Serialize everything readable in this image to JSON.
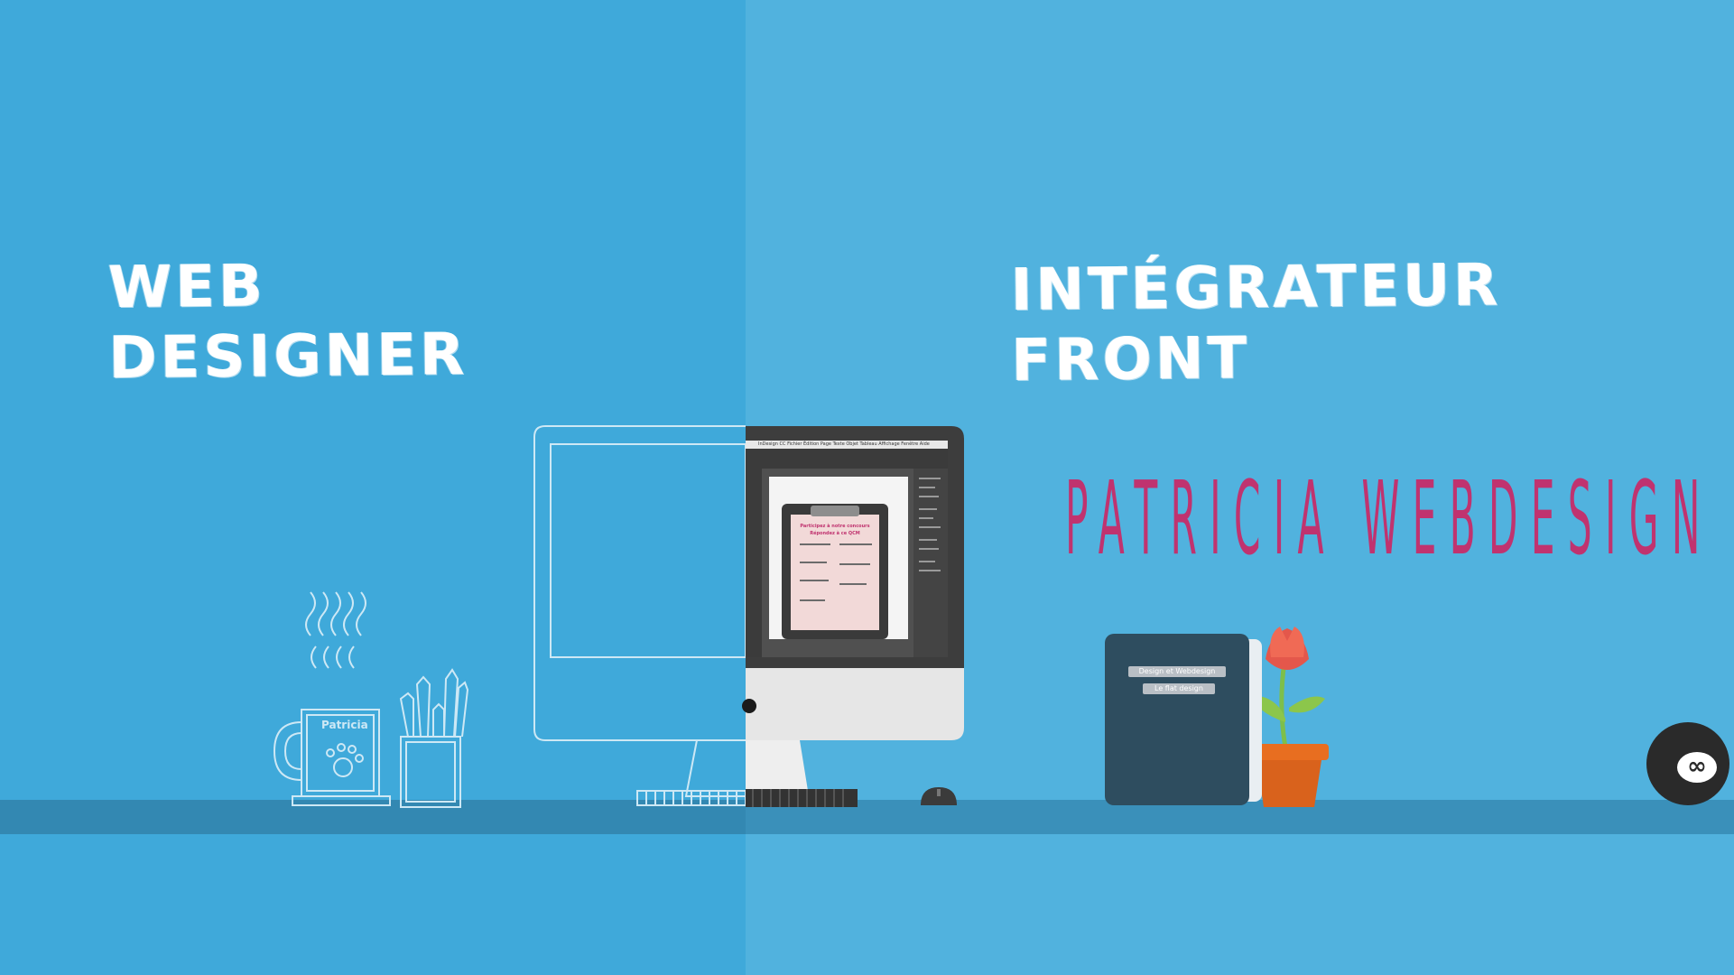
{
  "left_title": {
    "line1": "WEB",
    "line2": "DESIGNER"
  },
  "right_title": {
    "line1": "INTÉGRATEUR",
    "line2": "FRONT"
  },
  "brand": "PATRICIA WEBDESIGN",
  "mug_label": "Patricia",
  "app": {
    "menu": "InDesign CC   Fichier   Édition   Page   Texte   Objet   Tableau   Affichage   Fenêtre   Aide",
    "doc_title_1": "Participez à notre concours",
    "doc_title_2": "Répondez à ce QCM"
  },
  "book": {
    "label1": "Design et Webdesign",
    "label2": "Le flat design"
  },
  "record_icon": "infinity-icon",
  "colors": {
    "left_bg": "#3fa9da",
    "right_bg": "#51b2de",
    "shelf": "#3388b2",
    "brand": "#c0336f",
    "book_cover": "#2e4d5f",
    "pot": "#d9621c",
    "flower": "#e4574b"
  }
}
